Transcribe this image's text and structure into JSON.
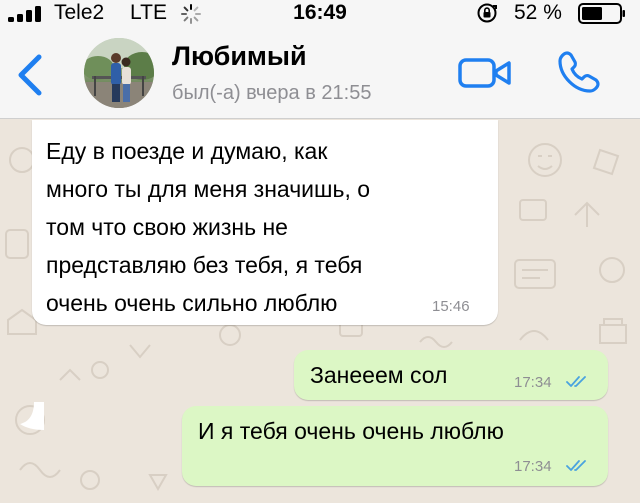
{
  "status_bar": {
    "carrier": "Tele2",
    "network": "LTE",
    "time": "16:49",
    "battery": "52 %"
  },
  "header": {
    "contact_name": "Любимый",
    "last_seen": "был(-а) вчера в 21:55"
  },
  "messages": [
    {
      "direction": "incoming",
      "text": "Еду в поезде и думаю, как\nмного ты для меня значишь, о\nтом что свою жизнь не\nпредставляю без тебя, я тебя\nочень очень сильно люблю",
      "time": "15:46"
    },
    {
      "direction": "outgoing",
      "text": "Занееем сол",
      "time": "17:34",
      "status": "read"
    },
    {
      "direction": "outgoing",
      "text": "И я тебя очень очень люблю",
      "time": "17:34",
      "status": "read"
    }
  ],
  "colors": {
    "accent": "#1f7ff0",
    "outgoing_bubble": "#dcf7c5",
    "incoming_bubble": "#ffffff",
    "read_ticks": "#4aa3df",
    "wallpaper": "#ece5dc"
  }
}
